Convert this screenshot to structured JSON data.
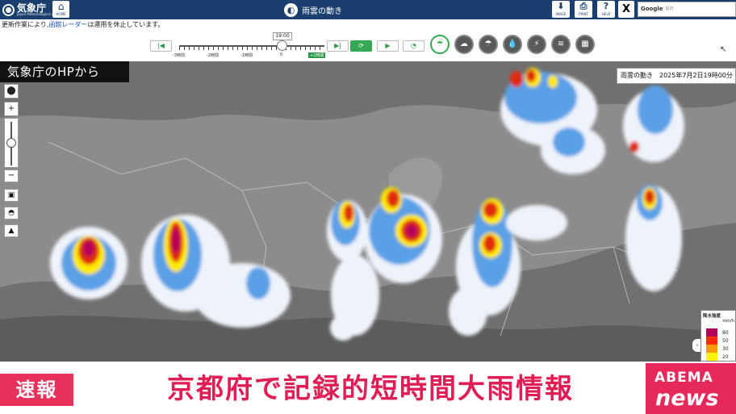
{
  "header": {
    "agency_name": "気象庁",
    "agency_name_en": "Japan Meteorological Agency",
    "home_label": "HOME",
    "page_title": "雨雲の動き",
    "buttons": [
      {
        "icon": "download-icon",
        "label": "IMAGE",
        "glyph": "⬇"
      },
      {
        "icon": "print-icon",
        "label": "PRINT",
        "glyph": "⎙"
      },
      {
        "icon": "help-icon",
        "label": "HELP",
        "glyph": "?"
      }
    ],
    "x_share": "X",
    "search": {
      "brand": "Google",
      "placeholder": "提供"
    }
  },
  "notice": {
    "prefix": "更新作業により,",
    "link": "函館レーダー",
    "suffix": "は運用を休止しています。"
  },
  "time_controls": {
    "current_time": "19:00",
    "tick_labels": [
      "-3時間",
      "-2時間",
      "-1時間",
      "0",
      "+1時間"
    ],
    "first_icon": "skip-back-icon",
    "last_icon": "skip-forward-icon",
    "refresh_icon": "refresh-icon",
    "play_icon": "play-icon",
    "speed_icon": "speed-icon"
  },
  "elements": [
    {
      "name": "raincloud",
      "icon": "raincloud-icon",
      "glyph": "☔",
      "active": true
    },
    {
      "name": "thunder-cloud",
      "icon": "cloud-icon",
      "glyph": "☁",
      "active": false
    },
    {
      "name": "cloud-heavy",
      "icon": "cloud-rain-icon",
      "glyph": "☂",
      "active": false
    },
    {
      "name": "drop",
      "icon": "drop-icon",
      "glyph": "💧",
      "active": false
    },
    {
      "name": "lightning",
      "icon": "lightning-icon",
      "glyph": "⚡",
      "active": false
    },
    {
      "name": "wind",
      "icon": "wind-icon",
      "glyph": "≋",
      "active": false
    },
    {
      "name": "extra",
      "icon": "layers-icon",
      "glyph": "▦",
      "active": false
    }
  ],
  "map": {
    "overlay_label": "気象庁のHPから",
    "datetime_label": "雨雲の動き　2025年7月2日19時00分",
    "tools": [
      "map-marker-icon",
      "zoom-in-icon",
      "zoom-out-icon",
      "basemap-icon",
      "layer-icon",
      "terrain-icon"
    ],
    "legend": {
      "title": "降水強度",
      "unit": "mm/h",
      "levels": [
        {
          "value": "80",
          "color": "#b4005a"
        },
        {
          "value": "50",
          "color": "#ff2800"
        },
        {
          "value": "30",
          "color": "#ff9900"
        },
        {
          "value": "20",
          "color": "#fff500"
        }
      ]
    }
  },
  "ticker": {
    "badge": "速報",
    "headline": "京都府で記録的短時間大雨情報",
    "brand_top": "ABEMA",
    "brand_bottom": "news"
  },
  "colors": {
    "header": "#1a3f6e",
    "accent_green": "#34a853",
    "ticker_pink": "#e8315a"
  }
}
